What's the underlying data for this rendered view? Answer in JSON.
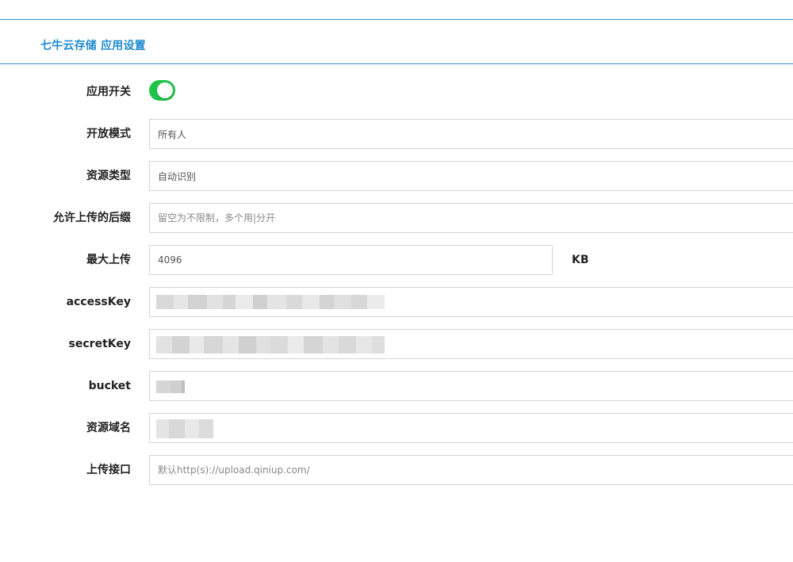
{
  "header": {
    "title": "七牛云存储 应用设置"
  },
  "colors": {
    "accent": "#1f8bd0",
    "toggle_on": "#22c34a"
  },
  "form": {
    "switch": {
      "label": "应用开关",
      "enabled": true
    },
    "open_mode": {
      "label": "开放模式",
      "value": "所有人"
    },
    "resource_type": {
      "label": "资源类型",
      "value": "自动识别"
    },
    "allowed_suffix": {
      "label": "允许上传的后缀",
      "value": "",
      "placeholder": "留空为不限制，多个用|分开"
    },
    "max_upload": {
      "label": "最大上传",
      "value": "4096",
      "unit": "KB"
    },
    "access_key": {
      "label": "accessKey",
      "value": ""
    },
    "secret_key": {
      "label": "secretKey",
      "value": ""
    },
    "bucket": {
      "label": "bucket",
      "value": ""
    },
    "domain": {
      "label": "资源域名",
      "value": ""
    },
    "upload_url": {
      "label": "上传接口",
      "value": "",
      "placeholder": "默认http(s)://upload.qiniup.com/"
    }
  }
}
